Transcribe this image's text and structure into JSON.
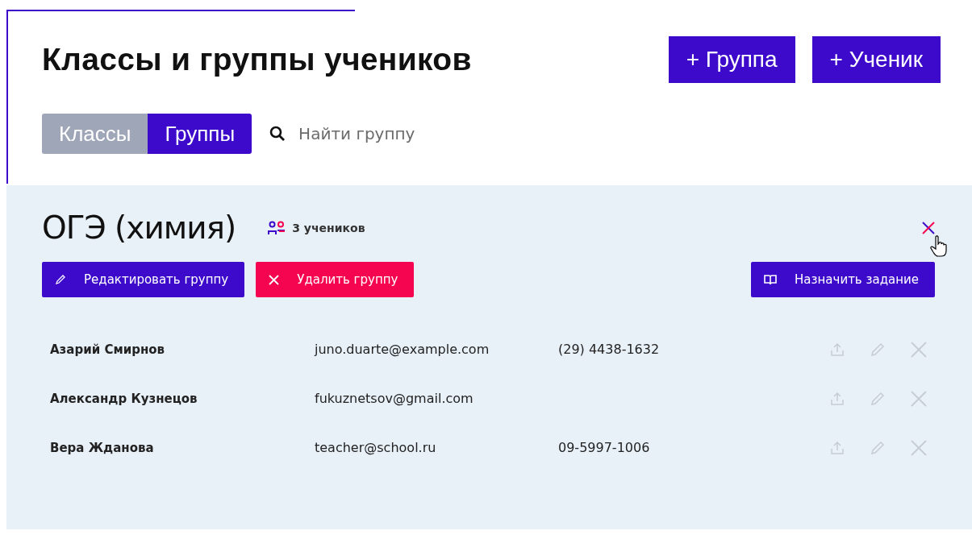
{
  "header": {
    "title": "Классы и группы учеников",
    "actions": [
      {
        "label": "+ Группа"
      },
      {
        "label": "+ Ученик"
      }
    ]
  },
  "tabs": [
    {
      "label": "Классы",
      "selected": false
    },
    {
      "label": "Группы",
      "selected": true
    }
  ],
  "search": {
    "placeholder": "Найти группу"
  },
  "group": {
    "name": "ОГЭ (химия)",
    "count": "3 учеников",
    "buttons": [
      {
        "kind": "edit",
        "label": "Редактировать группу"
      },
      {
        "kind": "delete",
        "label": "Удалить группу"
      },
      {
        "kind": "assign",
        "label": "Назначить задание"
      }
    ],
    "students": [
      {
        "name": "Азарий Смирнов",
        "email": "juno.duarte@example.com",
        "phone": "(29) 4438-1632"
      },
      {
        "name": "Александр Кузнецов",
        "email": "fukuznetsov@gmail.com"
      },
      {
        "name": "Вера Жданова",
        "email": "teacher@school.ru",
        "phone": "09-5997-1006"
      }
    ]
  }
}
